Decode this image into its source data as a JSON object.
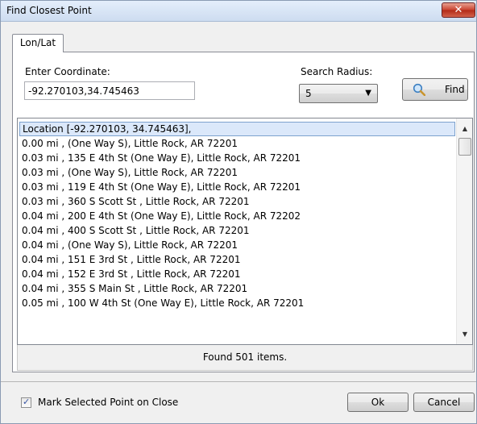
{
  "window": {
    "title": "Find Closest Point",
    "close_glyph": "✕"
  },
  "tabs": [
    {
      "label": "Lon/Lat"
    }
  ],
  "form": {
    "coordinate_label": "Enter Coordinate:",
    "coordinate_value": "-92.270103,34.745463",
    "radius_label": "Search Radius:",
    "radius_value": "5",
    "find_label": "Find"
  },
  "results": {
    "items": [
      "Location [-92.270103, 34.745463],",
      "0.00 mi ,  (One Way S), Little Rock, AR 72201",
      "0.03 mi , 135 E 4th St (One Way E), Little Rock, AR 72201",
      "0.03 mi ,  (One Way S), Little Rock, AR 72201",
      "0.03 mi , 119 E 4th St (One Way E), Little Rock, AR 72201",
      "0.03 mi , 360 S Scott St , Little Rock, AR 72201",
      "0.04 mi , 200 E 4th St (One Way E), Little Rock, AR 72202",
      "0.04 mi , 400 S Scott St , Little Rock, AR 72201",
      "0.04 mi ,  (One Way S), Little Rock, AR 72201",
      "0.04 mi , 151 E 3rd St , Little Rock, AR 72201",
      "0.04 mi , 152 E 3rd St , Little Rock, AR 72201",
      "0.04 mi , 355 S Main St , Little Rock, AR 72201",
      "0.05 mi , 100 W 4th St (One Way E), Little Rock, AR 72201"
    ],
    "status": "Found 501 items."
  },
  "footer": {
    "mark_label": "Mark Selected Point on Close",
    "mark_checked": true,
    "ok_label": "Ok",
    "cancel_label": "Cancel"
  }
}
